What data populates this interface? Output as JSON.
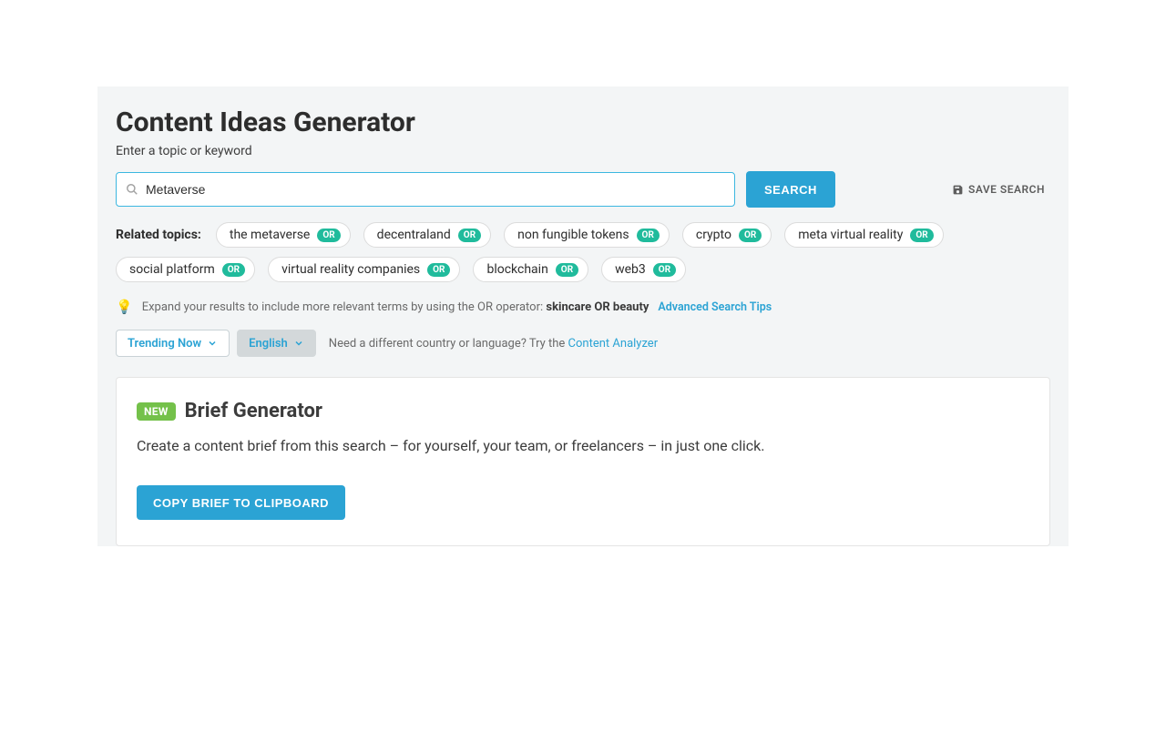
{
  "header": {
    "title": "Content Ideas Generator",
    "subtitle": "Enter a topic or keyword"
  },
  "search": {
    "value": "Metaverse",
    "button": "SEARCH",
    "save_label": "SAVE SEARCH"
  },
  "related": {
    "label": "Related topics:",
    "or": "OR",
    "items": [
      "the metaverse",
      "decentraland",
      "non fungible tokens",
      "crypto",
      "meta virtual reality",
      "social platform",
      "virtual reality companies",
      "blockchain",
      "web3"
    ]
  },
  "tip": {
    "text_prefix": "Expand your results to include more relevant terms by using the OR operator: ",
    "text_bold": "skincare OR beauty",
    "link": "Advanced Search Tips"
  },
  "filters": {
    "trending": "Trending Now",
    "language": "English",
    "note_prefix": "Need a different country or language? Try the ",
    "note_link": "Content Analyzer"
  },
  "brief": {
    "pill": "NEW",
    "title": "Brief Generator",
    "desc": "Create a content brief from this search – for yourself, your team, or freelancers – in just one click.",
    "button": "COPY BRIEF TO CLIPBOARD"
  }
}
